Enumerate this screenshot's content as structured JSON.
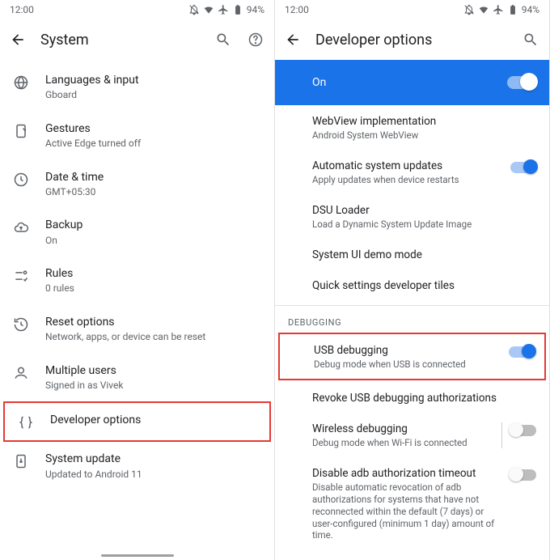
{
  "status": {
    "time": "12:00",
    "battery": "94%"
  },
  "left": {
    "title": "System",
    "items": [
      {
        "icon": "globe-icon",
        "label": "Languages & input",
        "sub": "Gboard"
      },
      {
        "icon": "gesture-icon",
        "label": "Gestures",
        "sub": "Active Edge turned off"
      },
      {
        "icon": "clock-icon",
        "label": "Date & time",
        "sub": "GMT+05:30"
      },
      {
        "icon": "cloud-icon",
        "label": "Backup",
        "sub": "On"
      },
      {
        "icon": "rules-icon",
        "label": "Rules",
        "sub": "0 rules"
      },
      {
        "icon": "reset-icon",
        "label": "Reset options",
        "sub": "Network, apps, or device can be reset"
      },
      {
        "icon": "users-icon",
        "label": "Multiple users",
        "sub": "Signed in as Vivek"
      },
      {
        "icon": "braces-icon",
        "label": "Developer options",
        "sub": ""
      },
      {
        "icon": "update-icon",
        "label": "System update",
        "sub": "Updated to Android 11"
      }
    ]
  },
  "right": {
    "title": "Developer options",
    "master": "On",
    "items": [
      {
        "label": "WebView implementation",
        "sub": "Android System WebView",
        "toggle": null
      },
      {
        "label": "Automatic system updates",
        "sub": "Apply updates when device restarts",
        "toggle": "on"
      },
      {
        "label": "DSU Loader",
        "sub": "Load a Dynamic System Update Image",
        "toggle": null
      },
      {
        "label": "System UI demo mode",
        "sub": "",
        "toggle": null
      },
      {
        "label": "Quick settings developer tiles",
        "sub": "",
        "toggle": null
      }
    ],
    "debug_section": "DEBUGGING",
    "debug_items": [
      {
        "label": "USB debugging",
        "sub": "Debug mode when USB is connected",
        "toggle": "on",
        "highlight": true
      },
      {
        "label": "Revoke USB debugging authorizations",
        "sub": "",
        "toggle": null
      },
      {
        "label": "Wireless debugging",
        "sub": "Debug mode when Wi-Fi is connected",
        "toggle": "off",
        "sep": true
      },
      {
        "label": "Disable adb authorization timeout",
        "sub": "Disable automatic revocation of adb authorizations for systems that have not reconnected within the default (7 days) or user-configured (minimum 1 day) amount of time.",
        "toggle": "off"
      }
    ]
  }
}
